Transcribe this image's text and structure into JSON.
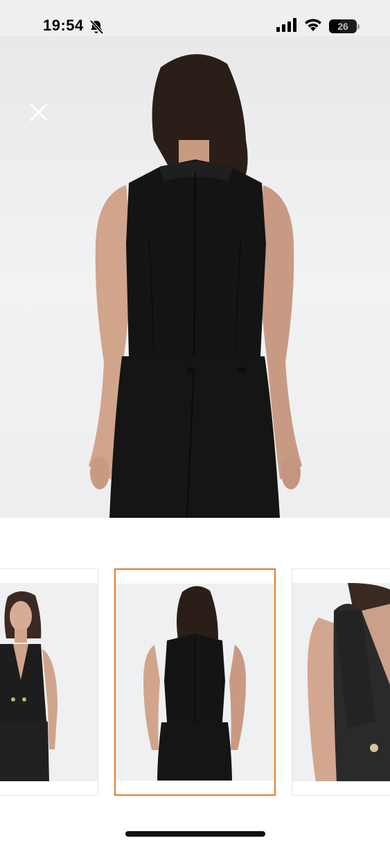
{
  "status_bar": {
    "time": "19:54",
    "battery_percent": "26",
    "icons": [
      "bell-slash-icon",
      "signal-icon",
      "wifi-icon",
      "battery-icon"
    ]
  },
  "viewer": {
    "close_icon": "close-icon",
    "main_image": "product-back-view",
    "thumbnails": [
      {
        "name": "front-view",
        "selected": false
      },
      {
        "name": "back-view",
        "selected": true
      },
      {
        "name": "side-detail-view",
        "selected": false
      }
    ]
  },
  "colors": {
    "selection_border": "#e07c2a",
    "garment": "#141414",
    "background": "#eef0f1"
  }
}
